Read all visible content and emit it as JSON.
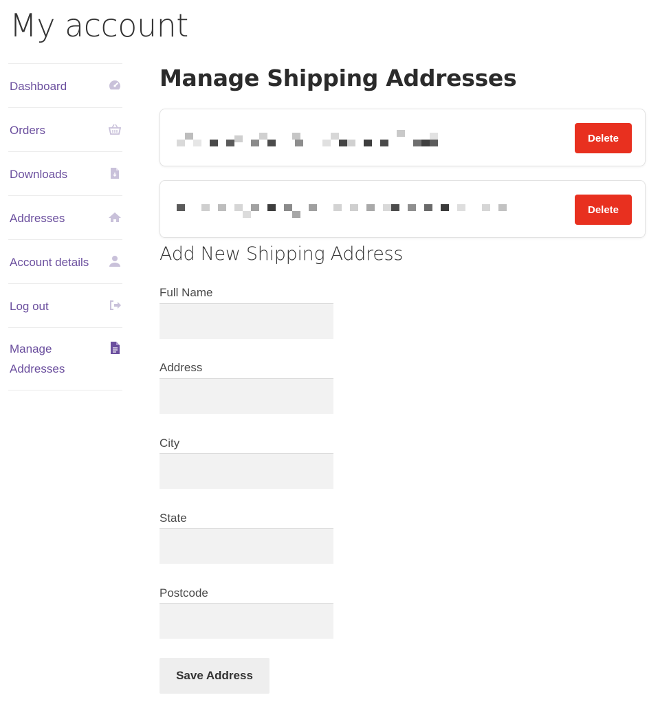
{
  "page": {
    "title": "My account"
  },
  "sidebar": {
    "items": [
      {
        "label": "Dashboard",
        "icon": "dashboard-icon"
      },
      {
        "label": "Orders",
        "icon": "basket-icon"
      },
      {
        "label": "Downloads",
        "icon": "file-download-icon"
      },
      {
        "label": "Addresses",
        "icon": "home-icon"
      },
      {
        "label": "Account details",
        "icon": "user-icon"
      },
      {
        "label": "Log out",
        "icon": "logout-icon"
      },
      {
        "label": "Manage Addresses",
        "icon": "document-icon",
        "active": true
      }
    ],
    "text_color": "#6b4f9e",
    "icon_color": "#c9c1da",
    "active_icon_color": "#6b4f9e"
  },
  "main": {
    "heading": "Manage Shipping Addresses",
    "addresses": [
      {
        "delete_label": "Delete"
      },
      {
        "delete_label": "Delete"
      }
    ],
    "delete_color": "#e8301f",
    "form": {
      "heading": "Add New Shipping Address",
      "fields": [
        {
          "label": "Full Name",
          "value": ""
        },
        {
          "label": "Address",
          "value": ""
        },
        {
          "label": "City",
          "value": ""
        },
        {
          "label": "State",
          "value": ""
        },
        {
          "label": "Postcode",
          "value": ""
        }
      ],
      "submit_label": "Save Address"
    }
  }
}
